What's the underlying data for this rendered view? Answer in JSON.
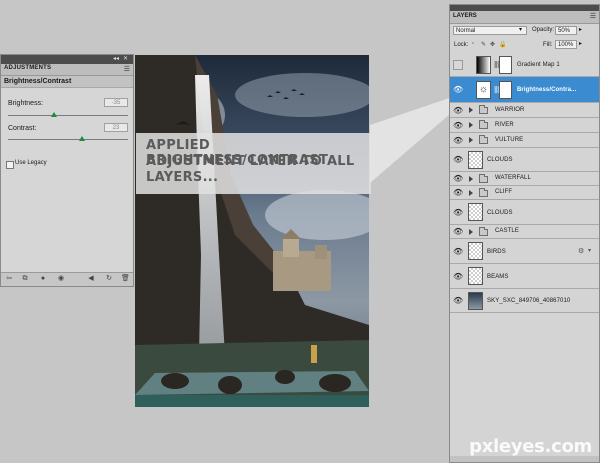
{
  "adjustments": {
    "tab_label": "ADJUSTMENTS",
    "header": "Brightness/Contrast",
    "brightness_label": "Brightness:",
    "brightness_value": "-35",
    "contrast_label": "Contrast:",
    "contrast_value": "23",
    "legacy_label": "Use Legacy",
    "legacy_checked": false,
    "accent_color": "#1f8a3a"
  },
  "canvas": {
    "banner_lines": [
      "APPLIED BRIGHTNESS/CONTRAST",
      "ADJUSTMENT LAYER TO ALL",
      "LAYERS..."
    ]
  },
  "layers_panel": {
    "tab_label": "LAYERS",
    "blend_mode": "Normal",
    "opacity_label": "Opacity:",
    "opacity_value": "50%",
    "lock_label": "Lock:",
    "fill_label": "Fill:",
    "fill_value": "100%",
    "selection_color": "#3b8bd1",
    "layers": [
      {
        "name": "Gradient Map 1",
        "kind": "adjustment",
        "visible": false
      },
      {
        "name": "Brightness/Contra...",
        "kind": "adjustment",
        "visible": true,
        "selected": true
      },
      {
        "name": "WARRIOR",
        "kind": "group",
        "visible": true
      },
      {
        "name": "RIVER",
        "kind": "group",
        "visible": true
      },
      {
        "name": "VULTURE",
        "kind": "group",
        "visible": true
      },
      {
        "name": "CLOUDS",
        "kind": "layer",
        "visible": true
      },
      {
        "name": "WATERFALL",
        "kind": "group",
        "visible": true
      },
      {
        "name": "CLIFF",
        "kind": "group",
        "visible": true
      },
      {
        "name": "CLOUDS",
        "kind": "layer",
        "visible": true
      },
      {
        "name": "CASTLE",
        "kind": "group",
        "visible": true
      },
      {
        "name": "BIRDS",
        "kind": "layer",
        "visible": true
      },
      {
        "name": "BEAMS",
        "kind": "layer",
        "visible": true
      },
      {
        "name": "SKY_SXC_849706_40867010",
        "kind": "layer",
        "visible": true
      }
    ]
  },
  "watermark": "pxleyes.com"
}
